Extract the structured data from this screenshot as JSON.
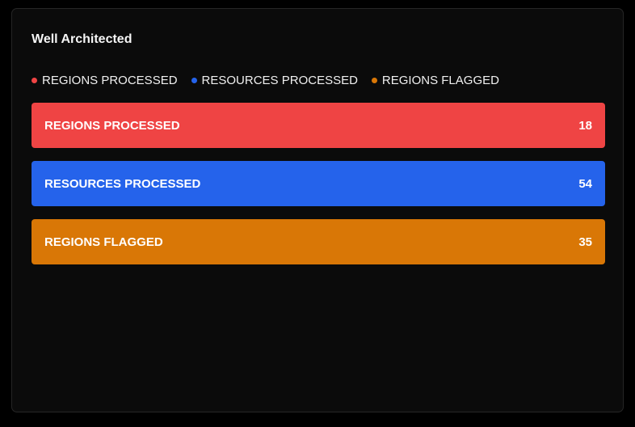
{
  "card": {
    "title": "Well Architected"
  },
  "legend": [
    {
      "label": "REGIONS PROCESSED",
      "color": "#ef4444"
    },
    {
      "label": "RESOURCES PROCESSED",
      "color": "#2563eb"
    },
    {
      "label": "REGIONS FLAGGED",
      "color": "#d97706"
    }
  ],
  "metrics": [
    {
      "label": "REGIONS PROCESSED",
      "value": "18",
      "color": "#ef4444"
    },
    {
      "label": "RESOURCES PROCESSED",
      "value": "54",
      "color": "#2563eb"
    },
    {
      "label": "REGIONS FLAGGED",
      "value": "35",
      "color": "#d97706"
    }
  ]
}
